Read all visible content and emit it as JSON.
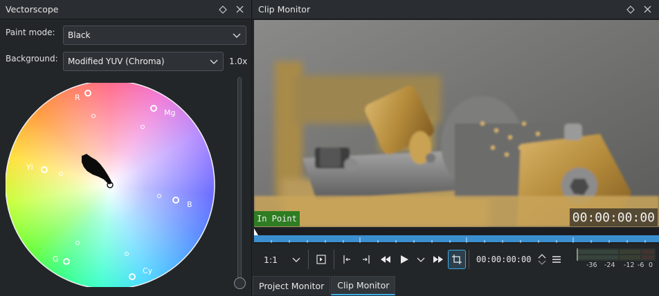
{
  "vectorscope": {
    "title": "Vectorscope",
    "paint_mode_label": "Paint mode:",
    "paint_mode_value": "Black",
    "background_label": "Background:",
    "background_value": "Modified YUV (Chroma)",
    "gain": "1.0x",
    "targets": {
      "R": "R",
      "Mg": "Mg",
      "B": "B",
      "Cy": "Cy",
      "G": "G",
      "Yl": "Yl"
    }
  },
  "clip_monitor": {
    "title": "Clip Monitor",
    "in_point_label": "In Point",
    "overlay_timecode": "00:00:00:00",
    "zoom_value": "1:1",
    "timecode": "00:00:00:00",
    "meter_scale": [
      "-36",
      "-24",
      "-12",
      "-6",
      "0"
    ],
    "tabs": [
      "Project Monitor",
      "Clip Monitor"
    ],
    "active_tab": "Clip Monitor"
  },
  "colors": {
    "accent": "#3daee9",
    "in_point_bg": "#2e7d22",
    "ruler": "#3b8fcf"
  },
  "icons": [
    "float-icon",
    "close-icon",
    "chevron-down-icon",
    "insert-zone-icon",
    "set-in-point-icon",
    "set-out-point-icon",
    "rewind-icon",
    "play-icon",
    "play-menu-icon",
    "fast-forward-icon",
    "crop-icon",
    "spin-arrows-icon",
    "hamburger-menu-icon"
  ]
}
